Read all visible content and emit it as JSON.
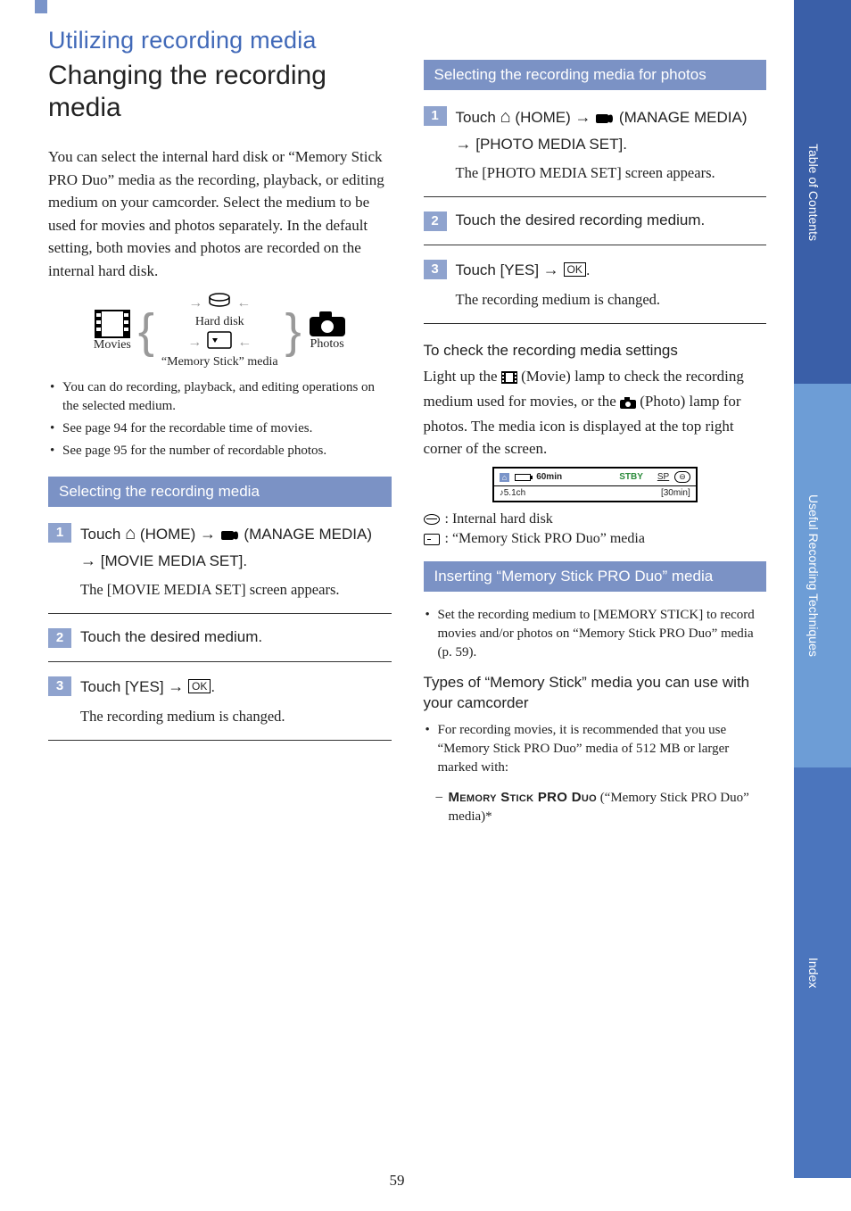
{
  "page_number": "59",
  "section_title": "Utilizing recording media",
  "main_heading": "Changing the recording media",
  "intro": "You can select the internal hard disk or “Memory Stick PRO Duo” media as the recording, playback, or editing medium on your camcorder. Select the medium to be used for movies and photos separately. In the default setting, both movies and photos are recorded on the internal hard disk.",
  "diagram": {
    "movies": "Movies",
    "photos": "Photos",
    "hard_disk": "Hard disk",
    "ms_media": "“Memory Stick” media"
  },
  "notes": [
    "You can do recording, playback, and editing operations on the selected medium.",
    "See page 94 for the recordable time of movies.",
    "See page 95 for the number of recordable photos."
  ],
  "sub1": {
    "title": "Selecting the recording media",
    "steps": [
      {
        "num": "1",
        "pre": "Touch ",
        "home": " (HOME) ",
        "mid": " (MANAGE MEDIA) ",
        "tail": " [MOVIE MEDIA SET].",
        "sub": "The [MOVIE MEDIA SET] screen appears."
      },
      {
        "num": "2",
        "title": "Touch the desired medium."
      },
      {
        "num": "3",
        "pre": "Touch [YES] ",
        "post": ".",
        "sub": "The recording medium is changed."
      }
    ]
  },
  "sub2": {
    "title": "Selecting the recording media for photos",
    "steps": [
      {
        "num": "1",
        "pre": "Touch ",
        "home": " (HOME) ",
        "mid": " (MANAGE MEDIA) ",
        "tail": " [PHOTO MEDIA SET].",
        "sub": "The [PHOTO MEDIA SET] screen appears."
      },
      {
        "num": "2",
        "title": "Touch the desired recording medium."
      },
      {
        "num": "3",
        "pre": "Touch [YES] ",
        "post": ".",
        "sub": "The recording medium is changed."
      }
    ]
  },
  "check": {
    "heading": "To check the recording media settings",
    "body_a": "Light up the ",
    "body_b": " (Movie) lamp to check the recording medium used for movies, or the ",
    "body_c": " (Photo) lamp for photos. The media icon is displayed at the top right corner of the screen.",
    "lcd": {
      "time": "60min",
      "stby": "STBY",
      "sp": "SP",
      "ch": "5.1ch",
      "remain": "[30min]"
    },
    "line1": ": Internal hard disk",
    "line2": ": “Memory Stick PRO Duo” media"
  },
  "sub3": {
    "title": "Inserting “Memory Stick PRO Duo” media",
    "bullet": "Set the recording medium to [MEMORY STICK] to record movies and/or photos on “Memory Stick PRO Duo” media (p. 59).",
    "types_heading": "Types of “Memory Stick” media you can use with your camcorder",
    "types_bullet": "For recording movies, it is recommended that you use “Memory Stick PRO Duo” media of 512 MB or larger marked with:",
    "dash_brand": "Memory Stick PRO Duo",
    "dash_tail": " (“Memory Stick PRO Duo” media)*"
  },
  "tabs": {
    "t1": "Table of Contents",
    "t2": "Useful Recording Techniques",
    "t3": "Index"
  },
  "glyphs": {
    "arrow": "→",
    "home": "⌂",
    "ok": "OK",
    "note": "♪"
  }
}
